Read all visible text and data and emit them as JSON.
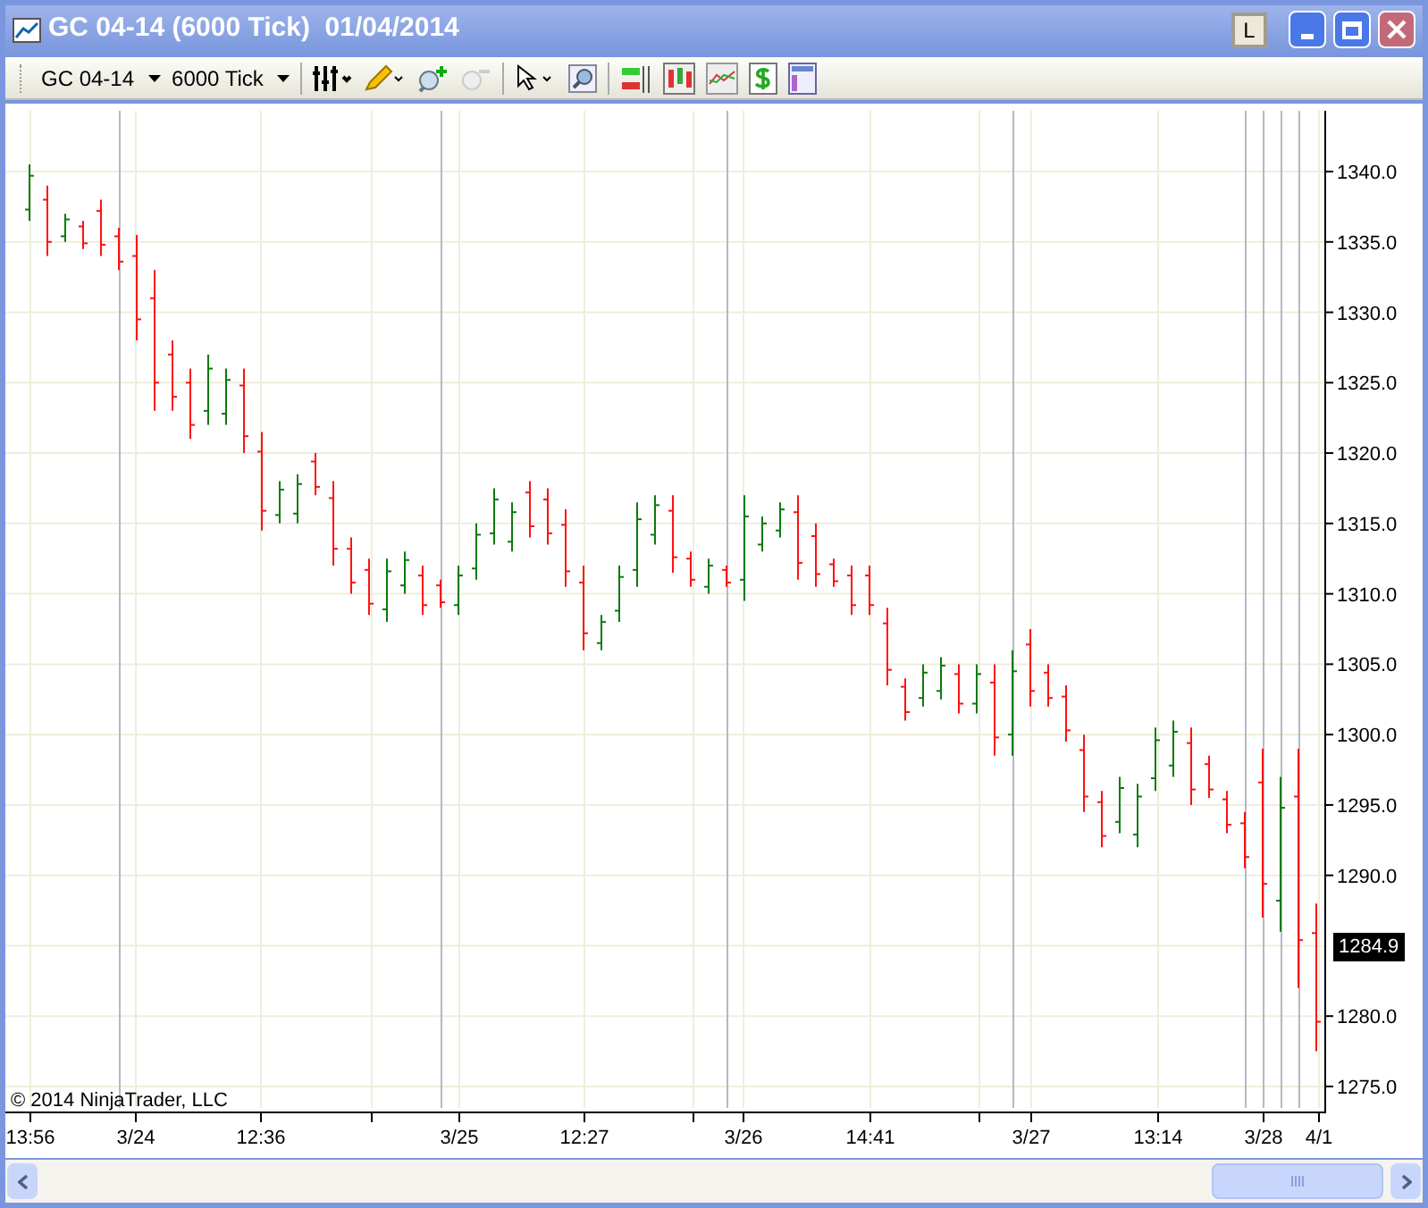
{
  "window": {
    "title": "GC 04-14 (6000 Tick)  01/04/2014",
    "layout_button": "L"
  },
  "toolbar": {
    "instrument": "GC 04-14",
    "period": "6000 Tick"
  },
  "chart": {
    "y_labels": [
      "1340.0",
      "1335.0",
      "1330.0",
      "1325.0",
      "1320.0",
      "1315.0",
      "1310.0",
      "1305.0",
      "1300.0",
      "1295.0",
      "1290.0",
      "1280.0",
      "1275.0"
    ],
    "x_labels": [
      "13:56",
      "3/24",
      "12:36",
      "3/25",
      "12:27",
      "3/26",
      "14:41",
      "3/27",
      "13:14",
      "3/28",
      "4/1"
    ],
    "last_price": "1284.9",
    "copyright": "© 2014 NinjaTrader, LLC"
  }
}
